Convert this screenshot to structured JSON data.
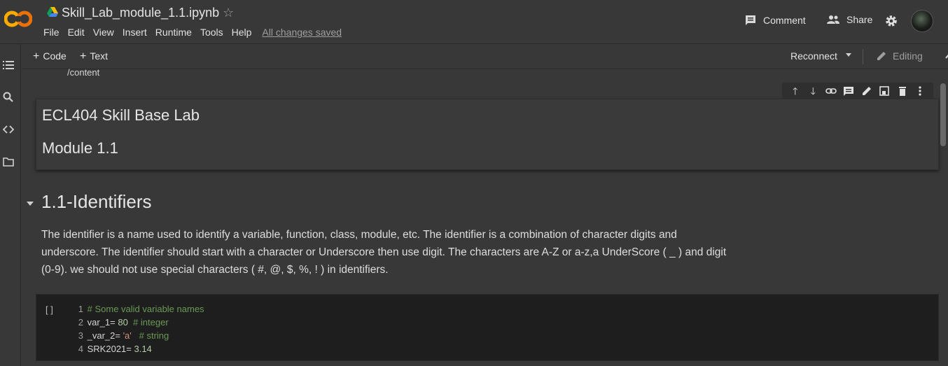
{
  "header": {
    "title": "Skill_Lab_module_1.1.ipynb",
    "menu": [
      "File",
      "Edit",
      "View",
      "Insert",
      "Runtime",
      "Tools",
      "Help"
    ],
    "save_status": "All changes saved",
    "comment_label": "Comment",
    "share_label": "Share"
  },
  "toolbar": {
    "add_code": "Code",
    "add_text": "Text",
    "reconnect": "Reconnect",
    "editing": "Editing"
  },
  "output": {
    "path": "/content"
  },
  "markdown_cell": {
    "heading1": "ECL404 Skill Base Lab",
    "heading2": "Module 1.1"
  },
  "section": {
    "title": "1.1-Identifiers",
    "paragraph_line1": "The identifier is a name used to identify a variable, function, class, module, etc. The identifier is a combination of character digits and",
    "paragraph_line2": "underscore. The identifier should start with a character or Underscore then use digit. The characters are A-Z or a-z,a UnderScore ( _ ) and digit",
    "paragraph_line3": "(0-9). we should not use special characters ( #, @, $, %, ! ) in identifiers."
  },
  "code_cell": {
    "run_indicator": "[ ]",
    "lines": [
      {
        "n": "1",
        "text": "# Some valid variable names"
      },
      {
        "n": "2",
        "code": "var_1= ",
        "value": "80",
        "comment": "  # integer"
      },
      {
        "n": "3",
        "code": "_var_2= ",
        "value": "'a'",
        "comment": "   # string"
      },
      {
        "n": "4",
        "code": "SRK2021= ",
        "value": "3.14"
      }
    ]
  }
}
